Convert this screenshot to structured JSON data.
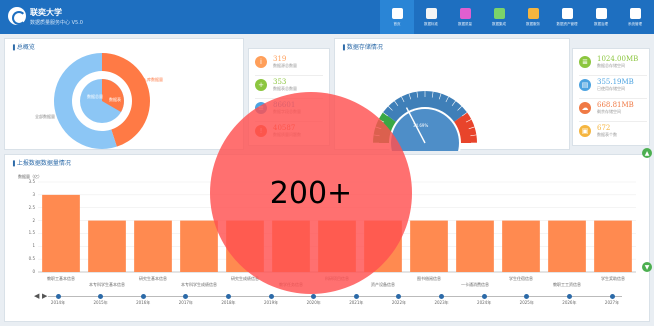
{
  "header": {
    "title": "联奕大学",
    "subtitle": "数据质量服务中心 V5.0",
    "nav": [
      {
        "label": "首页",
        "icon": "home-icon",
        "color": "#ffffff",
        "active": true
      },
      {
        "label": "数据标准",
        "icon": "document-icon",
        "color": "#f5f5f5"
      },
      {
        "label": "数据质量",
        "icon": "quality-icon",
        "color": "#e05fd0"
      },
      {
        "label": "数据集成",
        "icon": "integration-icon",
        "color": "#7bd36a"
      },
      {
        "label": "数据服务",
        "icon": "service-icon",
        "color": "#f5b53f"
      },
      {
        "label": "数据资产管理",
        "icon": "chart-icon",
        "color": "#ffffff"
      },
      {
        "label": "数据治理",
        "icon": "governance-icon",
        "color": "#ffffff"
      },
      {
        "label": "系统管理",
        "icon": "gear-icon",
        "color": "#ffffff"
      }
    ]
  },
  "panels": {
    "left_title": "总概览",
    "mid_title": "数据存储情况",
    "bottom_title": "上报数据数据量情况"
  },
  "donut": {
    "center_label": "数据总量",
    "inner_label": "数据表",
    "labels": [
      "入库数据量",
      "全部数据量"
    ],
    "segments": [
      {
        "name": "入库数据量",
        "fraction": 0.45,
        "color": "#ff7a45"
      },
      {
        "name": "全部数据量",
        "fraction": 0.55,
        "color": "#8cc6f5"
      }
    ]
  },
  "stats_left": [
    {
      "value": "319",
      "label": "数据源总数量",
      "icon": "info-icon",
      "color": "#ff9f5a",
      "glyph": "i"
    },
    {
      "value": "353",
      "label": "数据表总数量",
      "icon": "plus-icon",
      "color": "#8cc63f",
      "glyph": "+"
    },
    {
      "value": "86601",
      "label": "数据字段总数量",
      "icon": "table-icon",
      "color": "#4da3e0",
      "glyph": "≡"
    },
    {
      "value": "40587",
      "label": "数据质量问题数",
      "icon": "warning-icon",
      "color": "#f06a3a",
      "glyph": "!"
    }
  ],
  "stats_right": [
    {
      "value": "1024.00MB",
      "label": "数据总存储空间",
      "icon": "database-icon",
      "color": "#8cc63f",
      "glyph": "≣"
    },
    {
      "value": "355.19MB",
      "label": "已使用存储空间",
      "icon": "storage-icon",
      "color": "#4da3e0",
      "glyph": "▤"
    },
    {
      "value": "668.81MB",
      "label": "剩余存储空间",
      "icon": "cloud-icon",
      "color": "#f07a45",
      "glyph": "☁"
    },
    {
      "value": "672",
      "label": "数据表个数",
      "icon": "lock-icon",
      "color": "#f5b53f",
      "glyph": "▣"
    }
  ],
  "gauge": {
    "value_label": "34.69%",
    "percent": 34.69
  },
  "chart_data": {
    "type": "bar",
    "ylabel": "数据量（亿）",
    "ylim": [
      0,
      3.5
    ],
    "yticks": [
      "0",
      "0.5",
      "1",
      "1.5",
      "2",
      "2.5",
      "3",
      "3.5"
    ],
    "categories": [
      "教职工基本信息",
      "本专科学生基本信息",
      "研究生基本信息",
      "本专科学生成绩信息",
      "研究生成绩信息",
      "教学任务信息",
      "科研项目信息",
      "资产设备信息",
      "图书借阅信息",
      "一卡通消费信息",
      "学生住宿信息",
      "教职工工资信息",
      "学生奖助信息"
    ],
    "values": [
      3.0,
      2.0,
      2.0,
      2.0,
      2.0,
      2.0,
      2.0,
      2.0,
      2.0,
      2.0,
      2.0,
      2.0,
      2.0
    ],
    "bar_color": "#ff8a50"
  },
  "timeline": {
    "labels": [
      "2014年",
      "2015年",
      "2016年",
      "2017年",
      "2018年",
      "2019年",
      "2020年",
      "2021年",
      "2022年",
      "2023年",
      "2024年",
      "2025年",
      "2026年",
      "2027年"
    ],
    "play": "▶",
    "prev": "◀"
  },
  "overlay": {
    "text": "200+"
  }
}
